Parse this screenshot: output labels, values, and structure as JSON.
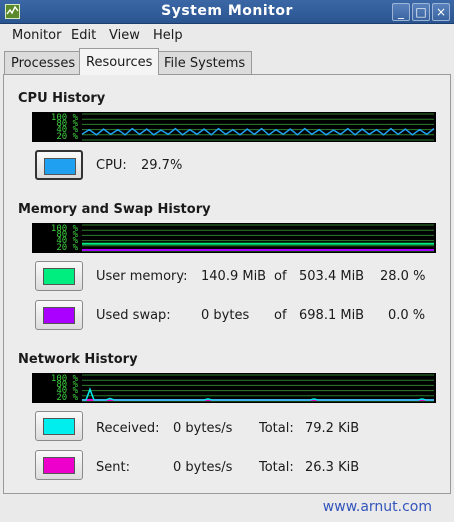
{
  "window": {
    "title": "System Monitor",
    "min": "_",
    "max": "□",
    "close": "×"
  },
  "menu": {
    "monitor": "Monitor",
    "edit": "Edit",
    "view": "View",
    "help": "Help"
  },
  "tabs": [
    "Processes",
    "Resources",
    "File Systems"
  ],
  "active_tab": "Resources",
  "cpu": {
    "title": "CPU History",
    "ticks": [
      "100 %",
      "80 %",
      "40 %",
      "20 %"
    ],
    "label": "CPU:",
    "value": "29.7%",
    "color": "#1fa0f0",
    "history": [
      22,
      40,
      20,
      42,
      22,
      40,
      20,
      44,
      22,
      42,
      20,
      38,
      22,
      44,
      20,
      40,
      22,
      42,
      20,
      44,
      22,
      40,
      20,
      42,
      22,
      44,
      20,
      40,
      22,
      42,
      20,
      44,
      22,
      40,
      20,
      38,
      22,
      44,
      20,
      42,
      22,
      40,
      20,
      44,
      22,
      42,
      20,
      40,
      22,
      44
    ]
  },
  "memory": {
    "title": "Memory and Swap History",
    "ticks": [
      "100 %",
      "80 %",
      "40 %",
      "20 %"
    ],
    "user": {
      "label": "User memory:",
      "used": "140.9 MiB",
      "of": "of",
      "total": "503.4 MiB",
      "pct": "28.0 %",
      "color": "#00ee80",
      "level": 28.0
    },
    "swap": {
      "label": "Used swap:",
      "used": "0 bytes",
      "of": "of",
      "total": "698.1 MiB",
      "pct": "0.0 %",
      "color": "#aa00ff",
      "level": 0.0
    }
  },
  "network": {
    "title": "Network History",
    "ticks": [
      "100 %",
      "80 %",
      "40 %",
      "20 %"
    ],
    "received": {
      "label": "Received:",
      "rate": "0 bytes/s",
      "total_label": "Total:",
      "total": "79.2 KiB",
      "color": "#00eeee"
    },
    "sent": {
      "label": "Sent:",
      "rate": "0 bytes/s",
      "total_label": "Total:",
      "total": "26.3 KiB",
      "color": "#ee00cc"
    }
  },
  "watermark": "www.arnut.com"
}
